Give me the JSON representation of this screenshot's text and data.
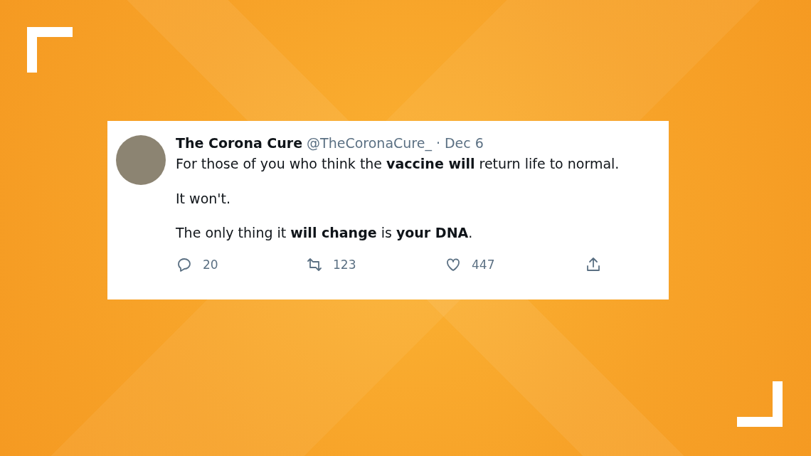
{
  "tweet": {
    "author": "The Corona Cure",
    "handle": "@TheCoronaCure_",
    "separator": "·",
    "date": "Dec 6",
    "paragraphs": [
      "For those of you who think the **vaccine will** return life to normal.",
      "It won't.",
      "The only thing it **will change** is **your DNA**."
    ],
    "actions": [
      {
        "kind": "reply",
        "count": "20"
      },
      {
        "kind": "retweet",
        "count": "123"
      },
      {
        "kind": "like",
        "count": "447"
      },
      {
        "kind": "share"
      }
    ]
  }
}
